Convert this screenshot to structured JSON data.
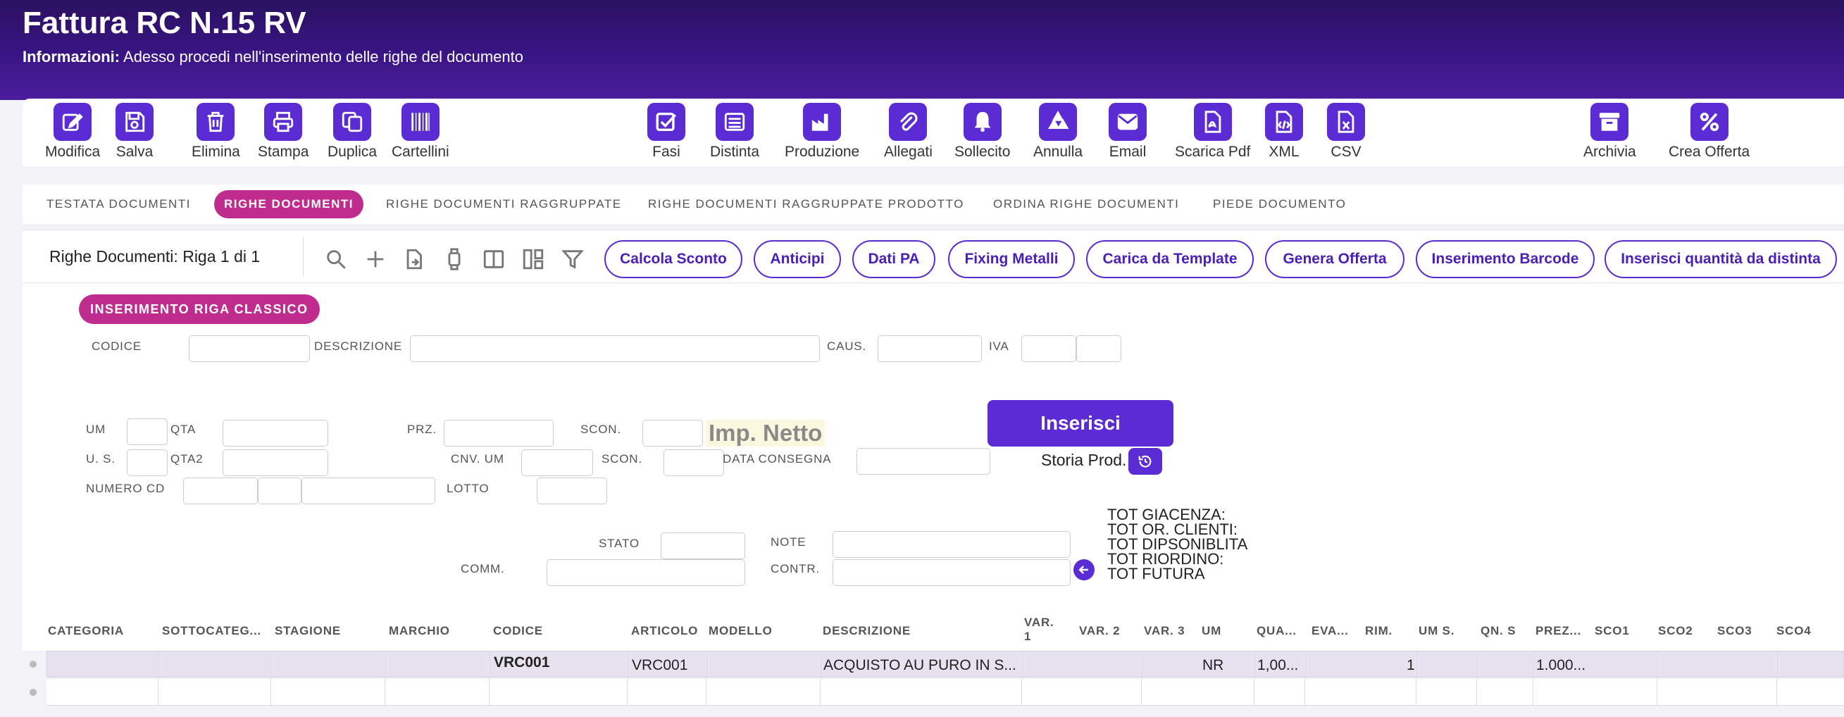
{
  "header": {
    "title": "Fattura RC N.15 RV",
    "info_label": "Informazioni:",
    "info_text": "Adesso procedi nell'inserimento delle righe del documento"
  },
  "toolbar": {
    "buttons": [
      {
        "label": "Modifica",
        "icon": "edit-icon"
      },
      {
        "label": "Salva",
        "icon": "save-icon"
      },
      {
        "label": "Elimina",
        "icon": "trash-icon"
      },
      {
        "label": "Stampa",
        "icon": "print-icon"
      },
      {
        "label": "Duplica",
        "icon": "copy-icon"
      },
      {
        "label": "Cartellini",
        "icon": "barcode-icon"
      },
      {
        "label": "Fasi",
        "icon": "checkbox-icon"
      },
      {
        "label": "Distinta",
        "icon": "list-icon"
      },
      {
        "label": "Produzione",
        "icon": "factory-icon"
      },
      {
        "label": "Allegati",
        "icon": "paperclip-icon"
      },
      {
        "label": "Sollecito",
        "icon": "bell-icon"
      },
      {
        "label": "Annulla",
        "icon": "recycle-icon"
      },
      {
        "label": "Email",
        "icon": "envelope-icon"
      },
      {
        "label": "Scarica Pdf",
        "icon": "pdf-icon"
      },
      {
        "label": "XML",
        "icon": "xml-icon"
      },
      {
        "label": "CSV",
        "icon": "csv-icon"
      },
      {
        "label": "Archivia",
        "icon": "archive-icon"
      },
      {
        "label": "Crea Offerta",
        "icon": "percent-icon"
      }
    ]
  },
  "tabs": [
    {
      "label": "TESTATA DOCUMENTI",
      "active": false
    },
    {
      "label": "RIGHE DOCUMENTI",
      "active": true
    },
    {
      "label": "RIGHE DOCUMENTI RAGGRUPPATE",
      "active": false
    },
    {
      "label": "RIGHE DOCUMENTI RAGGRUPPATE PRODOTTO",
      "active": false
    },
    {
      "label": "ORDINA RIGHE DOCUMENTI",
      "active": false
    },
    {
      "label": "PIEDE DOCUMENTO",
      "active": false
    }
  ],
  "actionbar": {
    "title": "Righe Documenti:",
    "record": "Riga 1 di 1",
    "icons": [
      "search-icon",
      "plus-icon",
      "export-icon",
      "watch-icon",
      "book-icon",
      "layout-icon",
      "filter-icon"
    ],
    "pills": [
      "Calcola Sconto",
      "Anticipi",
      "Dati PA",
      "Fixing Metalli",
      "Carica da Template",
      "Genera Offerta",
      "Inserimento Barcode",
      "Inserisci quantità da distinta"
    ]
  },
  "form": {
    "badge": "INSERIMENTO RIGA CLASSICO",
    "labels": {
      "codice": "CODICE",
      "descrizione": "DESCRIZIONE",
      "caus": "CAUS.",
      "iva": "IVA",
      "um": "UM",
      "qta": "QTA",
      "prz": "PRZ.",
      "scon1": "SCON.",
      "us": "U. S.",
      "qta2": "QTA2",
      "cnvum": "CNV. UM",
      "scon2": "SCON.",
      "data_consegna": "DATA CONSEGNA",
      "numero_cd": "NUMERO CD",
      "lotto": "LOTTO",
      "stato": "STATO",
      "note": "NOTE",
      "comm": "COMM.",
      "contr": "CONTR."
    },
    "imp_netto": "Imp. Netto",
    "inserisci": "Inserisci",
    "storia_prod": "Storia Prod.",
    "totals": [
      "TOT GIACENZA:",
      "TOT OR. CLIENTI:",
      "TOT DIPSONIBLITA",
      "TOT RIORDINO:",
      "TOT FUTURA"
    ]
  },
  "grid": {
    "columns": [
      "CATEGORIA",
      "SOTTOCATEG...",
      "STAGIONE",
      "MARCHIO",
      "CODICE",
      "ARTICOLO",
      "MODELLO",
      "DESCRIZIONE",
      "VAR. 1",
      "VAR. 2",
      "VAR. 3",
      "UM",
      "QUA...",
      "EVA...",
      "RIM.",
      "UM S.",
      "QN. S",
      "PREZ...",
      "SCO1",
      "SCO2",
      "SCO3",
      "SCO4"
    ],
    "rows": [
      {
        "codice": "VRC001",
        "articolo": "VRC001",
        "descrizione": "ACQUISTO AU PURO IN S...",
        "um": "NR",
        "quantita": "1,00...",
        "um_s": "1",
        "prezzo": "1.000..."
      }
    ]
  },
  "colors": {
    "accent": "#5b2bd3",
    "magenta": "#c02c8e",
    "header": "#3a1585"
  }
}
